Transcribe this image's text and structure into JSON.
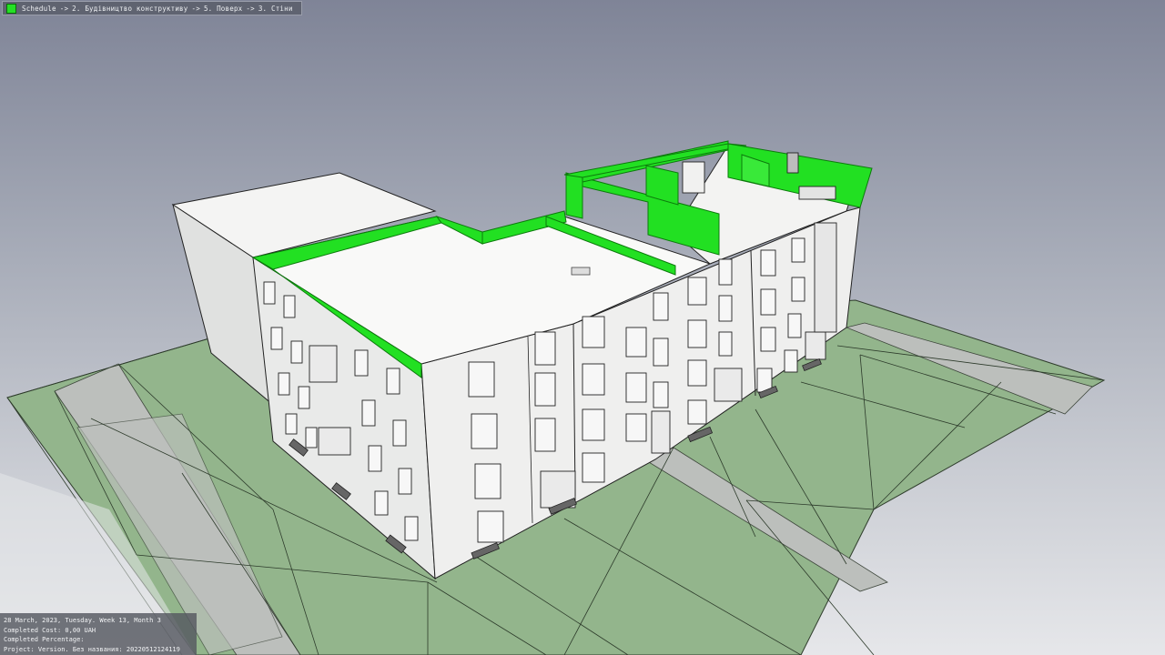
{
  "breadcrumb": {
    "items": [
      "Schedule",
      "2. Будівництво конструктиву",
      "5. Поверх",
      "3. Стіни"
    ],
    "separator": "->",
    "status_color": "#25e025"
  },
  "info_panel": {
    "date": "28 March, 2023, Tuesday. Week 13, Month 3",
    "completed_cost": "Completed Cost: 0,00 UAH",
    "completed_percentage": "Completed Percentage:",
    "project": "Project: Version. Без названия: 20220512124119"
  },
  "colors": {
    "highlight": "#22e022",
    "ground": "#93b58c",
    "path": "#bcbfbc",
    "wall": "#f0f1f0"
  }
}
